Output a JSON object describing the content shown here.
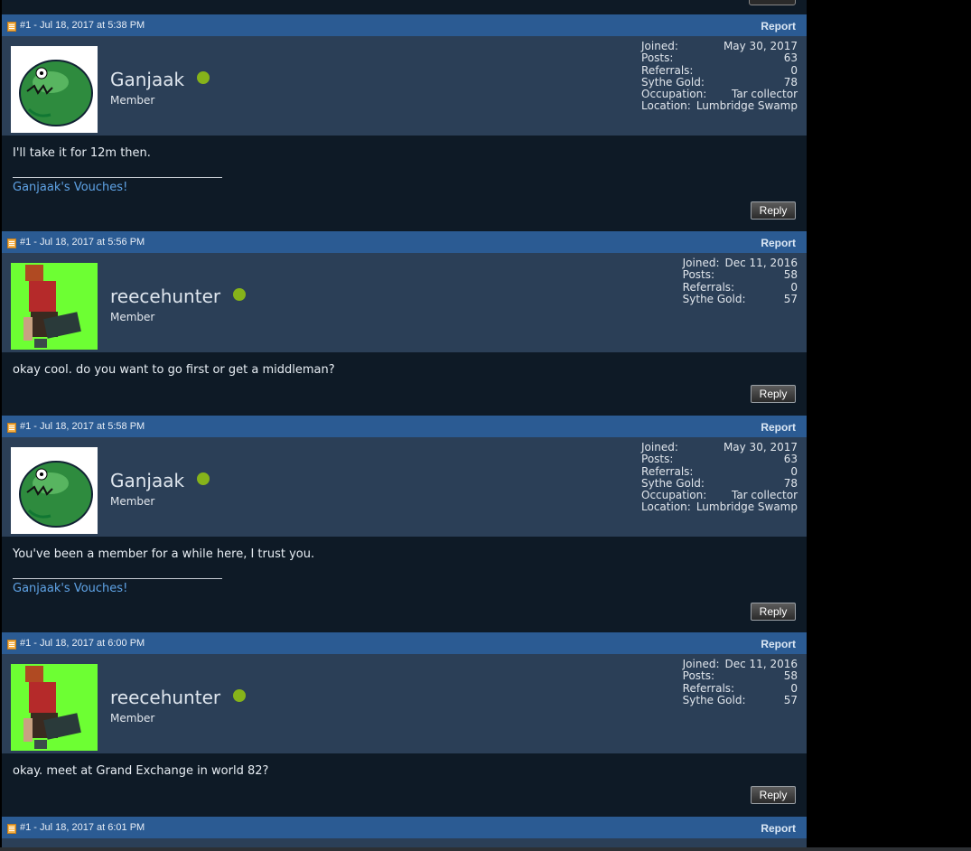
{
  "thread": {
    "posts": [
      {
        "meta": "#1 - Jul 18, 2017 at 5:38 PM",
        "report": "Report",
        "username": "Ganjaak",
        "title": "Member",
        "avatar_icon": "green-ghoul-avatar",
        "stats": [
          {
            "label": "Joined:",
            "value": "May 30, 2017"
          },
          {
            "label": "Posts:",
            "value": "63"
          },
          {
            "label": "Referrals:",
            "value": "0"
          },
          {
            "label": "Sythe Gold:",
            "value": "78"
          },
          {
            "label": "Occupation:",
            "value": "Tar collector"
          },
          {
            "label": "Location:",
            "value": "Lumbridge Swamp"
          }
        ],
        "message": "I'll take it for 12m then.",
        "signature": "Ganjaak's Vouches!",
        "reply": "Reply"
      },
      {
        "meta": "#1 - Jul 18, 2017 at 5:56 PM",
        "report": "Report",
        "username": "reecehunter",
        "title": "Member",
        "avatar_icon": "runescape-character-avatar",
        "stats": [
          {
            "label": "Joined:",
            "value": "Dec 11, 2016"
          },
          {
            "label": "Posts:",
            "value": "58"
          },
          {
            "label": "Referrals:",
            "value": "0"
          },
          {
            "label": "Sythe Gold:",
            "value": "57"
          }
        ],
        "message": "okay cool. do you want to go first or get a middleman?",
        "signature": "",
        "reply": "Reply"
      },
      {
        "meta": "#1 - Jul 18, 2017 at 5:58 PM",
        "report": "Report",
        "username": "Ganjaak",
        "title": "Member",
        "avatar_icon": "green-ghoul-avatar",
        "stats": [
          {
            "label": "Joined:",
            "value": "May 30, 2017"
          },
          {
            "label": "Posts:",
            "value": "63"
          },
          {
            "label": "Referrals:",
            "value": "0"
          },
          {
            "label": "Sythe Gold:",
            "value": "78"
          },
          {
            "label": "Occupation:",
            "value": "Tar collector"
          },
          {
            "label": "Location:",
            "value": "Lumbridge Swamp"
          }
        ],
        "message": "You've been a member for a while here, I trust you.",
        "signature": "Ganjaak's Vouches!",
        "reply": "Reply"
      },
      {
        "meta": "#1 - Jul 18, 2017 at 6:00 PM",
        "report": "Report",
        "username": "reecehunter",
        "title": "Member",
        "avatar_icon": "runescape-character-avatar",
        "stats": [
          {
            "label": "Joined:",
            "value": "Dec 11, 2016"
          },
          {
            "label": "Posts:",
            "value": "58"
          },
          {
            "label": "Referrals:",
            "value": "0"
          },
          {
            "label": "Sythe Gold:",
            "value": "57"
          }
        ],
        "message": "okay. meet at Grand Exchange in world 82?",
        "signature": "",
        "reply": "Reply"
      }
    ],
    "last_post": {
      "meta": "#1 - Jul 18, 2017 at 6:01 PM",
      "report": "Report"
    }
  },
  "colors": {
    "header_blue": "#2b5b93",
    "userinfo_bg": "#2b3f57",
    "body_bg": "#0e1a26",
    "online_green": "#86b31a",
    "link_blue": "#5fa3e6"
  }
}
